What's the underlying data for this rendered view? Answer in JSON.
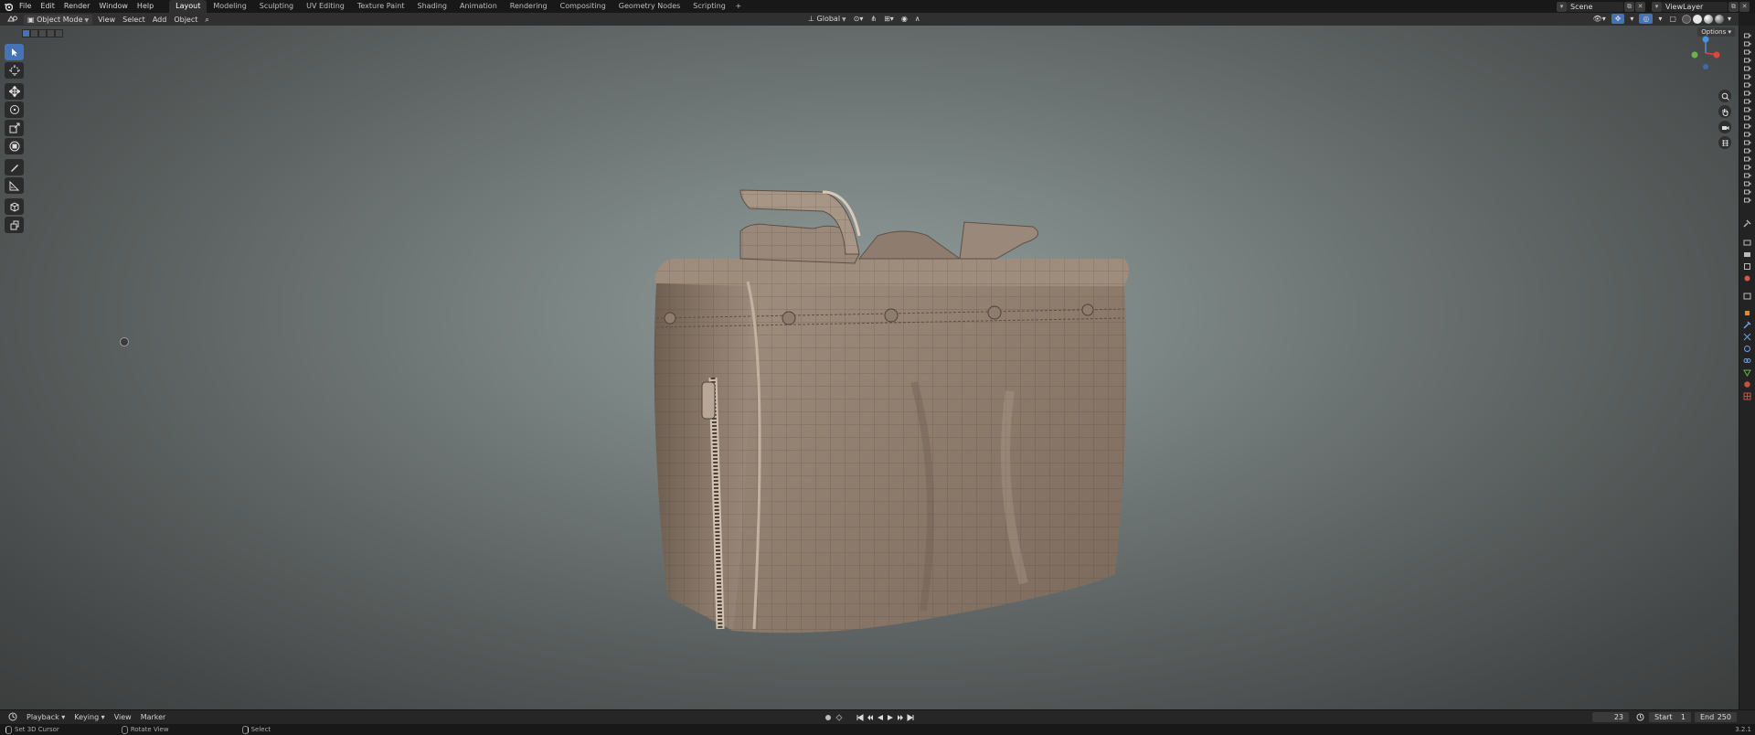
{
  "topbar": {
    "menus": [
      "File",
      "Edit",
      "Render",
      "Window",
      "Help"
    ],
    "workspaces": [
      "Layout",
      "Modeling",
      "Sculpting",
      "UV Editing",
      "Texture Paint",
      "Shading",
      "Animation",
      "Rendering",
      "Compositing",
      "Geometry Nodes",
      "Scripting"
    ],
    "active_workspace": "Layout",
    "add_workspace": "+",
    "scene": "Scene",
    "view_layer": "ViewLayer"
  },
  "viewport_header": {
    "mode": "Object Mode",
    "menus": [
      "View",
      "Select",
      "Add",
      "Object"
    ],
    "orientation": "Global",
    "options": "Options"
  },
  "timeline": {
    "menus": [
      "Playback",
      "Keying",
      "View",
      "Marker"
    ],
    "current_frame": "23",
    "start_label": "Start",
    "start": "1",
    "end_label": "End",
    "end": "250"
  },
  "statusbar": {
    "hints": [
      {
        "icon": "left-mouse-icon",
        "label": "Set 3D Cursor"
      },
      {
        "icon": "middle-mouse-icon",
        "label": "Rotate View"
      },
      {
        "icon": "right-mouse-icon",
        "label": "Select"
      }
    ],
    "version": "3.2.1"
  },
  "colors": {
    "accent": "#4772b3",
    "axis_x": "#e0453a",
    "axis_y": "#6fb04c",
    "axis_z": "#4d8fe0",
    "model": "#8b7a6b"
  },
  "toolbar_tools": [
    "select-box-icon",
    "cursor-icon",
    "move-icon",
    "rotate-icon",
    "scale-icon",
    "transform-icon",
    "annotate-icon",
    "measure-icon",
    "add-cube-icon",
    "extrude-icon"
  ]
}
